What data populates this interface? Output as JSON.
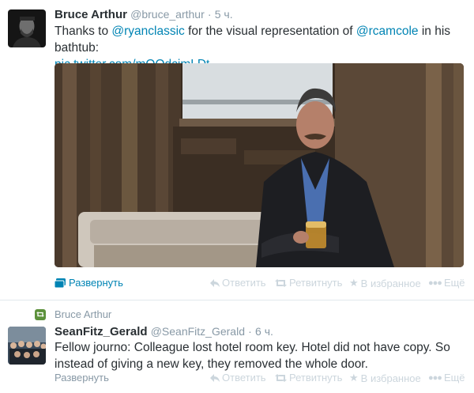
{
  "tweets": [
    {
      "fullname": "Bruce Arthur",
      "username": "@bruce_arthur",
      "separator": "·",
      "time": "5 ч.",
      "text": {
        "prefix": "Thanks to ",
        "mention1": "@ryanclassic",
        "middle": " for the visual representation of ",
        "mention2": "@rcamcole",
        "suffix": " in his bathtub:",
        "pic_link": "pic.twitter.com/mQQdcjmLDt"
      },
      "expand_label": "Развернуть",
      "actions": {
        "reply": "Ответить",
        "retweet": "Ретвитнуть",
        "favorite": "В избранное",
        "more": "Ещё"
      }
    },
    {
      "retweeted_by": "Bruce Arthur",
      "fullname": "SeanFitz_Gerald",
      "username": "@SeanFitz_Gerald",
      "separator": "·",
      "time": "6 ч.",
      "text": "Fellow journo: Colleague lost hotel room key. Hotel did not have copy. So instead of giving a new key, they removed the whole door.",
      "expand_label": "Развернуть",
      "actions": {
        "reply": "Ответить",
        "retweet": "Ретвитнуть",
        "favorite": "В избранное",
        "more": "Ещё"
      }
    }
  ],
  "icons": {
    "expand": "media-card-icon",
    "reply": "reply-arrow-icon",
    "retweet": "retweet-arrows-icon",
    "favorite": "star-icon",
    "more": "three-dots-icon"
  },
  "colors": {
    "link": "#0084b4",
    "muted": "#8899a6",
    "action": "#ccd6dd",
    "retweet_badge": "#5c913b",
    "text": "#292f33"
  }
}
